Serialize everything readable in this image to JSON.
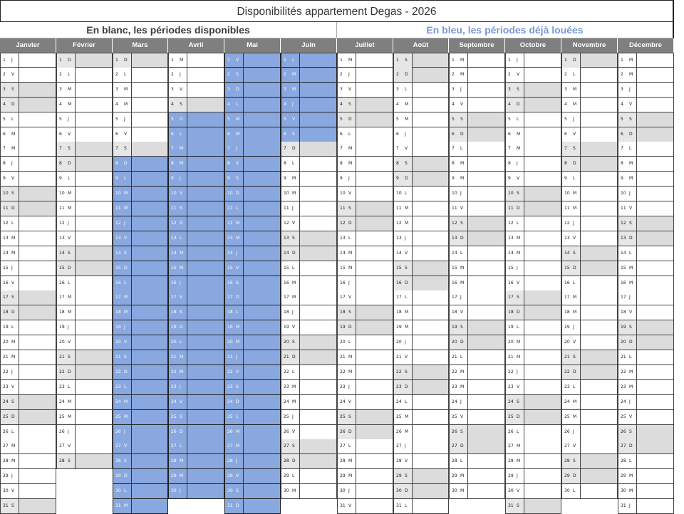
{
  "title": "Disponibilités appartement Degas - 2026",
  "legend": {
    "available": "En blanc, les périodes disponibles",
    "booked": "En bleu, les périodes déjà louées"
  },
  "colors": {
    "booked": "#8aa8e0",
    "weekend": "#dcdcdc",
    "header": "#7f7f7f",
    "legend_booked": "#7a97d6"
  },
  "months": [
    {
      "name": "Janvier",
      "first_weekday": 3,
      "days": 31,
      "booked": []
    },
    {
      "name": "Février",
      "first_weekday": 6,
      "days": 28,
      "booked": []
    },
    {
      "name": "Mars",
      "first_weekday": 6,
      "days": 31,
      "booked": [
        [
          8,
          31
        ]
      ]
    },
    {
      "name": "Avril",
      "first_weekday": 2,
      "days": 30,
      "booked": [
        [
          5,
          30
        ]
      ]
    },
    {
      "name": "Mai",
      "first_weekday": 4,
      "days": 31,
      "booked": [
        [
          1,
          31
        ]
      ]
    },
    {
      "name": "Juin",
      "first_weekday": 0,
      "days": 30,
      "booked": [
        [
          1,
          6
        ]
      ]
    },
    {
      "name": "Juillet",
      "first_weekday": 2,
      "days": 31,
      "booked": []
    },
    {
      "name": "Août",
      "first_weekday": 5,
      "days": 31,
      "booked": []
    },
    {
      "name": "Septembre",
      "first_weekday": 1,
      "days": 30,
      "booked": []
    },
    {
      "name": "Octobre",
      "first_weekday": 3,
      "days": 31,
      "booked": []
    },
    {
      "name": "Novembre",
      "first_weekday": 6,
      "days": 30,
      "booked": []
    },
    {
      "name": "Décembre",
      "first_weekday": 1,
      "days": 31,
      "booked": []
    }
  ],
  "weekday_letters": [
    "L",
    "M",
    "M",
    "J",
    "V",
    "S",
    "D"
  ]
}
